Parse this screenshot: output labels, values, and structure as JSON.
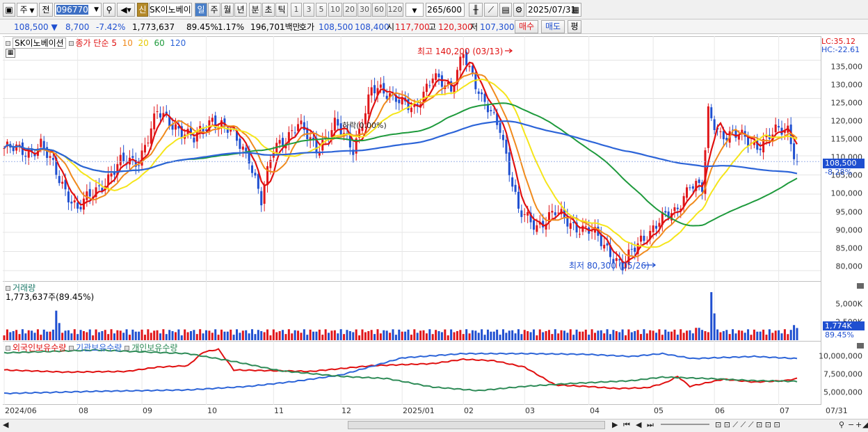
{
  "toolbar": {
    "period": "주",
    "prev": "전",
    "code": "096770",
    "new_badge": "신",
    "name": "SK이노베이",
    "day": "일",
    "week": "주",
    "month": "월",
    "year": "년",
    "minute": "분",
    "second": "초",
    "tick": "틱",
    "periods": [
      "1",
      "3",
      "5",
      "10",
      "20",
      "30",
      "60",
      "120"
    ],
    "count": "265",
    "count_max": "/600",
    "date": "2025/07/31"
  },
  "quote": {
    "price": "108,500",
    "change": "8,700",
    "change_pct": "-7.42%",
    "volume": "1,773,637",
    "vol_ratio": "89.45%",
    "turnover_rate": "1.17%",
    "amount": "196,701백만",
    "bid_label": "호가",
    "ask_price": "108,500",
    "bid_price": "108,400",
    "open_label": "시",
    "open": "117,700",
    "high_label": "고",
    "high": "120,300",
    "low_label": "저",
    "low": "107,300",
    "buy_label": "매수",
    "sell_label": "매도",
    "eval_label": "평"
  },
  "colors": {
    "candle_up": "#e0161a",
    "candle_down": "#1f4fd0",
    "ma5": "#e01010",
    "ma10": "#f08a1c",
    "ma20": "#f5e51a",
    "ma60": "#1e9a3c",
    "ma120": "#2c64d8",
    "foreign": "#e01010",
    "institution": "#2c64d8",
    "individual": "#2e8b57"
  },
  "price_panel": {
    "stock_label": "SK이노베이션",
    "ma_label": "종가 단순",
    "ma_periods": [
      "5",
      "10",
      "20",
      "60",
      "120"
    ],
    "lc": "LC:35.12",
    "hc": "HC:-22.61",
    "current_tag": "108,500",
    "current_pct": "-8.28%",
    "high_note": "최고 140,200 (03/13)",
    "low_note": "최저 80,300 (05/26)",
    "mid_note": "하락(0.00%)",
    "yticks": [
      "135,000",
      "130,000",
      "125,000",
      "120,000",
      "115,000",
      "110,000",
      "105,000",
      "100,000",
      "95,000",
      "90,000",
      "85,000",
      "80,000"
    ]
  },
  "volume_panel": {
    "title": "거래량",
    "current": "1,773,637주(89.45%)",
    "tick": "5,000K",
    "tick2": "2,500K",
    "current_tag": "1,774K",
    "ratio_tag": "89.45%"
  },
  "holding_panel": {
    "s1": "외국인보유수량",
    "s2": "기관보유수량",
    "s3": "개인보유수량",
    "yticks": [
      "10,000,000",
      "7,500,000",
      "5,000,000"
    ]
  },
  "x_labels": [
    "2024/06",
    "08",
    "09",
    "10",
    "11",
    "12",
    "2025/01",
    "02",
    "03",
    "04",
    "05",
    "06",
    "07"
  ],
  "x_end_label": "07/31",
  "chart_data": {
    "type": "line",
    "title": "SK이노베이션",
    "y_range": [
      78000,
      138000
    ],
    "anchors": [
      {
        "i": 0,
        "v": 112000
      },
      {
        "i": 8,
        "v": 111000
      },
      {
        "i": 12,
        "v": 113000
      },
      {
        "i": 18,
        "v": 104000
      },
      {
        "i": 24,
        "v": 96000
      },
      {
        "i": 30,
        "v": 101000
      },
      {
        "i": 38,
        "v": 108000
      },
      {
        "i": 44,
        "v": 109000
      },
      {
        "i": 50,
        "v": 121000
      },
      {
        "i": 56,
        "v": 118000
      },
      {
        "i": 62,
        "v": 114000
      },
      {
        "i": 68,
        "v": 120000
      },
      {
        "i": 74,
        "v": 116000
      },
      {
        "i": 80,
        "v": 110000
      },
      {
        "i": 84,
        "v": 98000
      },
      {
        "i": 88,
        "v": 112000
      },
      {
        "i": 96,
        "v": 118000
      },
      {
        "i": 102,
        "v": 112000
      },
      {
        "i": 108,
        "v": 118000
      },
      {
        "i": 114,
        "v": 112000
      },
      {
        "i": 120,
        "v": 127000
      },
      {
        "i": 128,
        "v": 126000
      },
      {
        "i": 134,
        "v": 121000
      },
      {
        "i": 140,
        "v": 132000
      },
      {
        "i": 146,
        "v": 126000
      },
      {
        "i": 150,
        "v": 138000
      },
      {
        "i": 156,
        "v": 124000
      },
      {
        "i": 162,
        "v": 118000
      },
      {
        "i": 168,
        "v": 95000
      },
      {
        "i": 174,
        "v": 92000
      },
      {
        "i": 180,
        "v": 95000
      },
      {
        "i": 186,
        "v": 92000
      },
      {
        "i": 192,
        "v": 90000
      },
      {
        "i": 198,
        "v": 85000
      },
      {
        "i": 202,
        "v": 81000
      },
      {
        "i": 208,
        "v": 88000
      },
      {
        "i": 214,
        "v": 93000
      },
      {
        "i": 219,
        "v": 95000
      },
      {
        "i": 224,
        "v": 103000
      },
      {
        "i": 228,
        "v": 101000
      },
      {
        "i": 230,
        "v": 121000
      },
      {
        "i": 234,
        "v": 116000
      },
      {
        "i": 240,
        "v": 115000
      },
      {
        "i": 246,
        "v": 113000
      },
      {
        "i": 252,
        "v": 116000
      },
      {
        "i": 256,
        "v": 117000
      },
      {
        "i": 259,
        "v": 108500
      }
    ],
    "high": {
      "value": 140200,
      "date": "03/13"
    },
    "low": {
      "value": 80300,
      "date": "05/26"
    },
    "last_close": 108500,
    "volume_y_range": [
      0,
      7500000
    ],
    "holding_y_range": [
      3000000,
      11500000
    ],
    "holdings": [
      {
        "name": "외국인보유수량",
        "anchors": [
          [
            0,
            7900000
          ],
          [
            20,
            7600000
          ],
          [
            40,
            7700000
          ],
          [
            50,
            8300000
          ],
          [
            60,
            8500000
          ],
          [
            65,
            10400000
          ],
          [
            70,
            10800000
          ],
          [
            75,
            7900000
          ],
          [
            100,
            7700000
          ],
          [
            120,
            8500000
          ],
          [
            140,
            8800000
          ],
          [
            150,
            9400000
          ],
          [
            160,
            9200000
          ],
          [
            170,
            8300000
          ],
          [
            180,
            5800000
          ],
          [
            190,
            5600000
          ],
          [
            200,
            5300000
          ],
          [
            210,
            5400000
          ],
          [
            216,
            6100000
          ],
          [
            220,
            7000000
          ],
          [
            224,
            5600000
          ],
          [
            235,
            6600000
          ],
          [
            245,
            6200000
          ],
          [
            255,
            6400000
          ],
          [
            259,
            6700000
          ]
        ]
      },
      {
        "name": "기관보유수량",
        "anchors": [
          [
            0,
            4600000
          ],
          [
            30,
            4900000
          ],
          [
            60,
            5100000
          ],
          [
            80,
            5600000
          ],
          [
            95,
            6300000
          ],
          [
            110,
            7200000
          ],
          [
            130,
            9600000
          ],
          [
            150,
            10200000
          ],
          [
            170,
            10200000
          ],
          [
            190,
            10100000
          ],
          [
            205,
            9800000
          ],
          [
            215,
            10200000
          ],
          [
            225,
            9500000
          ],
          [
            245,
            9800000
          ],
          [
            259,
            9500000
          ]
        ]
      },
      {
        "name": "개인보유수량",
        "anchors": [
          [
            0,
            10300000
          ],
          [
            30,
            10700000
          ],
          [
            60,
            10200000
          ],
          [
            75,
            9100000
          ],
          [
            90,
            7800000
          ],
          [
            110,
            7000000
          ],
          [
            125,
            6700000
          ],
          [
            140,
            5500000
          ],
          [
            155,
            5000000
          ],
          [
            170,
            5600000
          ],
          [
            185,
            6000000
          ],
          [
            205,
            6400000
          ],
          [
            215,
            6900000
          ],
          [
            230,
            6700000
          ],
          [
            245,
            6400000
          ],
          [
            259,
            6300000
          ]
        ]
      }
    ]
  }
}
